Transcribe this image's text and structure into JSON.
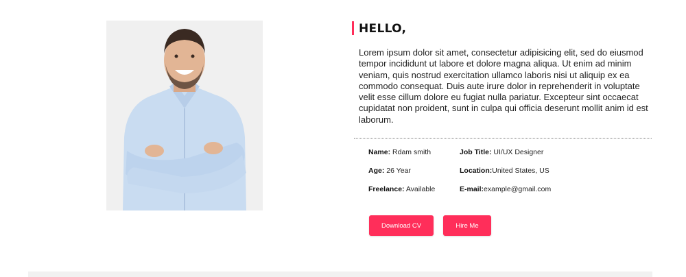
{
  "about": {
    "heading": "HELLO,",
    "bio": "Lorem ipsum dolor sit amet, consectetur adipisicing elit, sed do eiusmod tempor incididunt ut labore et dolore magna aliqua. Ut enim ad minim veniam, quis nostrud exercitation ullamco laboris nisi ut aliquip ex ea commodo consequat. Duis aute irure dolor in reprehenderit in voluptate velit esse cillum dolore eu fugiat nulla pariatur. Excepteur sint occaecat cupidatat non proident, sunt in culpa qui officia deserunt mollit anim id est laborum."
  },
  "details": {
    "name_label": "Name:",
    "name_value": " Rdam smith",
    "age_label": "Age:",
    "age_value": " 26 Year",
    "freelance_label": "Freelance:",
    "freelance_value": " Available",
    "job_label": "Job Title:",
    "job_value": " UI/UX Designer",
    "location_label": "Location:",
    "location_value": "United States, US",
    "email_label": "E-mail:",
    "email_value": "example@gmail.com"
  },
  "buttons": {
    "download_cv": "Download CV",
    "hire_me": "Hire Me"
  },
  "colors": {
    "accent": "#ff2e5a",
    "photo_background": "#f0f0f0"
  },
  "icons": {
    "profile_photo": "portrait-photo"
  }
}
